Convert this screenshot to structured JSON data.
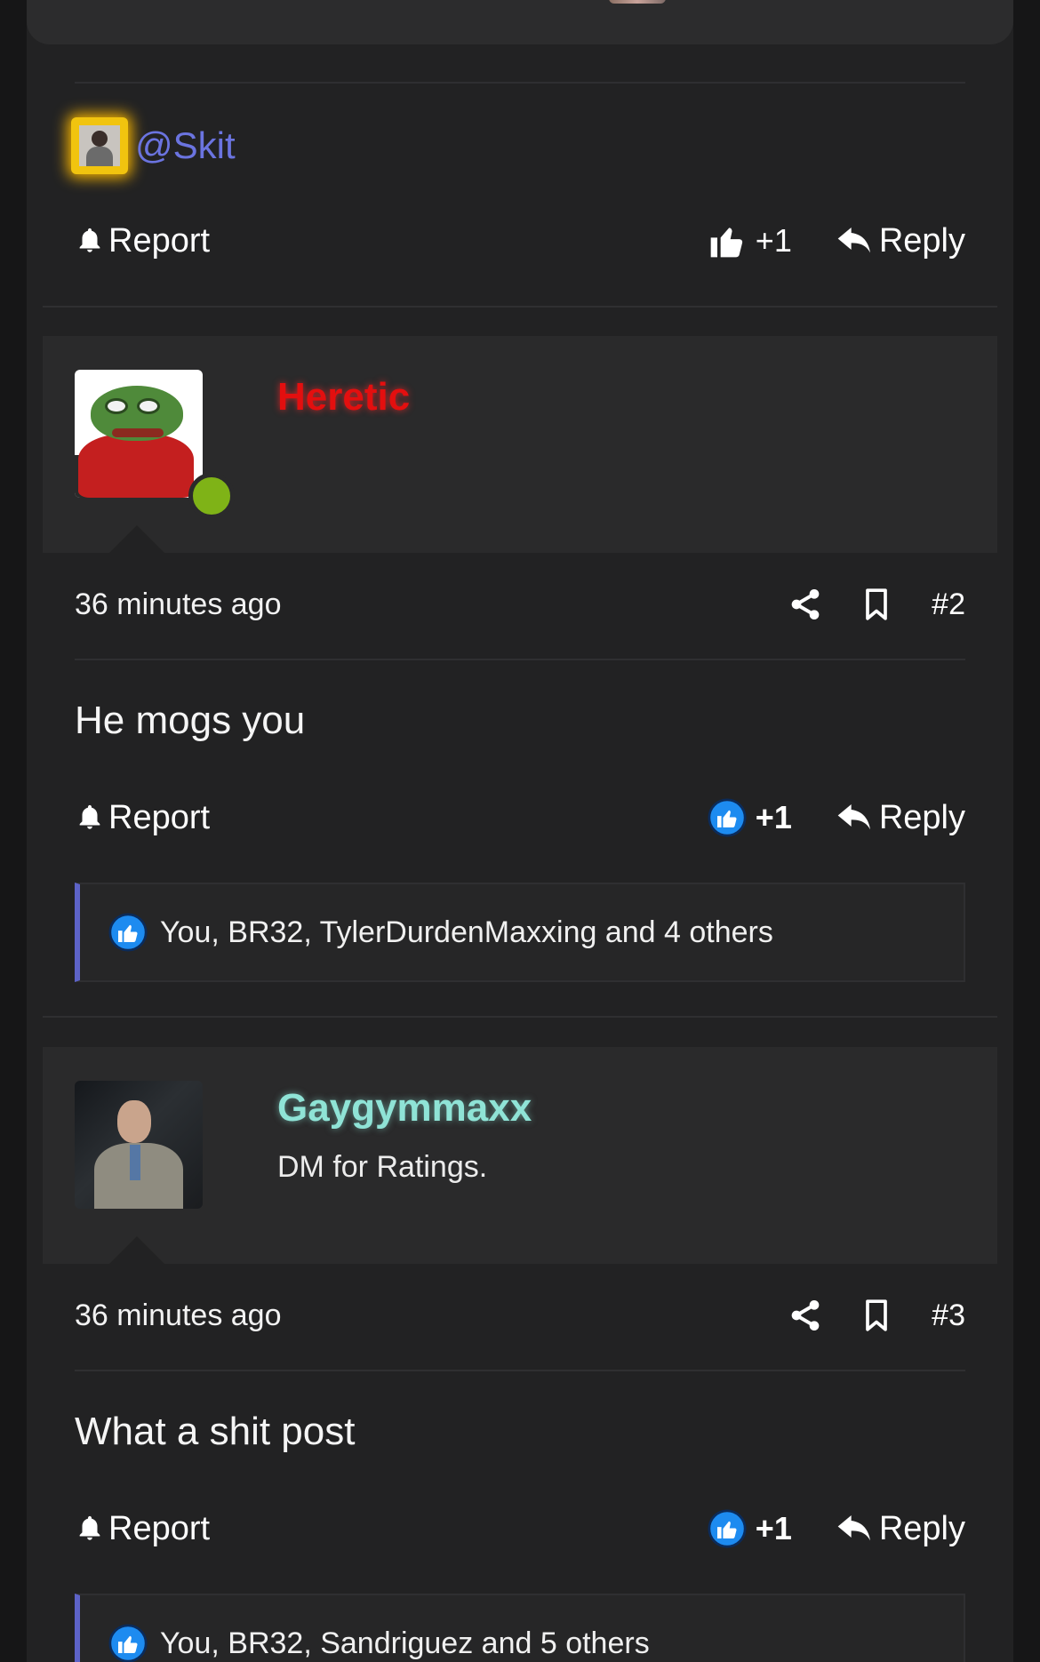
{
  "quote": {
    "mention": "@Skit",
    "actions": {
      "report": "Report",
      "likes": "+1",
      "reply": "Reply"
    }
  },
  "posts": [
    {
      "username": "Heretic",
      "user_title": "",
      "time": "36 minutes ago",
      "number": "#2",
      "body": "He mogs you",
      "actions": {
        "report": "Report",
        "likes": "+1",
        "reply": "Reply"
      },
      "liked_by": "You, BR32, TylerDurdenMaxxing and 4 others",
      "online": true
    },
    {
      "username": "Gaygymmaxx",
      "user_title": "DM for Ratings.",
      "time": "36 minutes ago",
      "number": "#3",
      "body": "What a shit post",
      "actions": {
        "report": "Report",
        "likes": "+1",
        "reply": "Reply"
      },
      "liked_by": "You, BR32, Sandriguez and 5 others",
      "online": false
    }
  ],
  "colors": {
    "background": "#161617",
    "column": "#222223",
    "mention": "#6b74e0",
    "heretic": "#e30f0f",
    "gaygymmaxx": "#8fe3d6",
    "online": "#7fb317",
    "like_blue": "#1d8bf0",
    "quote_accent": "#5d63c7"
  },
  "icons": [
    "bell-icon",
    "thumbs-up-icon",
    "reply-icon",
    "share-icon",
    "bookmark-icon",
    "like-reaction-icon"
  ]
}
